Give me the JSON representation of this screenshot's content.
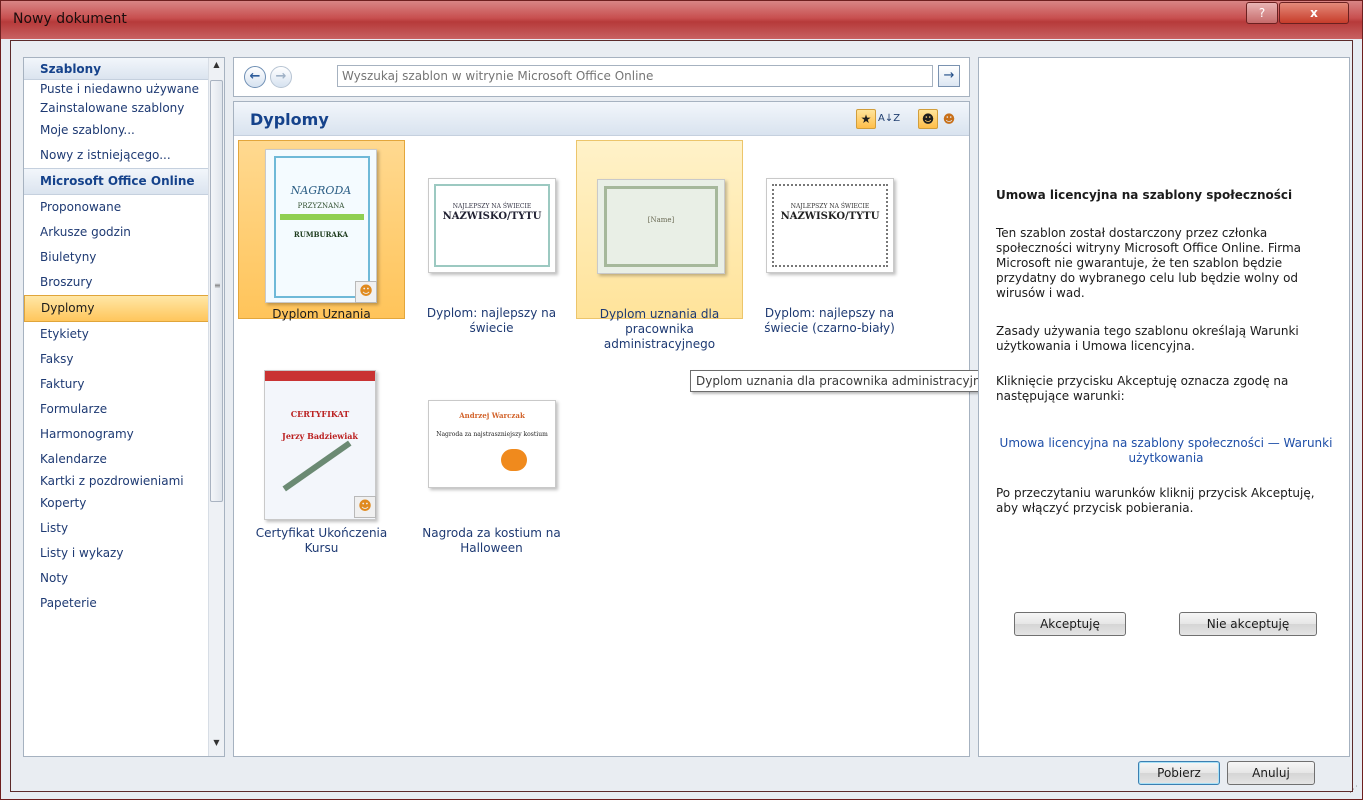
{
  "window": {
    "title": "Nowy dokument",
    "help_label": "?",
    "close_label": "x"
  },
  "sidebar": {
    "header": "Szablony",
    "items": [
      {
        "label": "Puste i niedawno używane"
      },
      {
        "label": "Zainstalowane szablony"
      },
      {
        "label": "Moje szablony..."
      },
      {
        "label": "Nowy z istniejącego..."
      },
      {
        "label": "Microsoft Office Online"
      },
      {
        "label": "Proponowane"
      },
      {
        "label": "Arkusze godzin"
      },
      {
        "label": "Biuletyny"
      },
      {
        "label": "Broszury"
      },
      {
        "label": "Dyplomy"
      },
      {
        "label": "Etykiety"
      },
      {
        "label": "Faksy"
      },
      {
        "label": "Faktury"
      },
      {
        "label": "Formularze"
      },
      {
        "label": "Harmonogramy"
      },
      {
        "label": "Kalendarze"
      },
      {
        "label": "Kartki z pozdrowieniami"
      },
      {
        "label": "Koperty"
      },
      {
        "label": "Listy"
      },
      {
        "label": "Listy i wykazy"
      },
      {
        "label": "Noty"
      },
      {
        "label": "Papeterie"
      }
    ],
    "selected": "Dyplomy"
  },
  "search": {
    "back_label": "←",
    "forward_label": "→",
    "placeholder": "Wyszukaj szablon w witrynie Microsoft Office Online",
    "go_label": "→"
  },
  "gallery": {
    "title": "Dyplomy",
    "sort_label": "A↓Z",
    "templates": [
      {
        "label": "Dyplom Uznania",
        "thumb_title": "NAGRODA",
        "thumb_name": "RUMBURAKA",
        "thumb_small": "PRZYZNANA"
      },
      {
        "label": "Dyplom: najlepszy na świecie",
        "thumb_title": "NAJLEPSZY NA ŚWIECIE",
        "thumb_name": "NAZWISKO/TYTU"
      },
      {
        "label": "Dyplom uznania dla pracownika administracyjnego",
        "thumb_name": "[Name]"
      },
      {
        "label": "Dyplom: najlepszy na świecie (czarno-biały)",
        "thumb_title": "NAJLEPSZY NA ŚWIECIE",
        "thumb_name": "NAZWISKO/TYTU"
      },
      {
        "label": "Certyfikat Ukończenia Kursu",
        "thumb_title": "CERTYFIKAT",
        "thumb_name": "Jerzy Badziewiak"
      },
      {
        "label": "Nagroda za kostium na Halloween",
        "thumb_title": "Andrzej Warczak",
        "thumb_name": "Nagroda za najstraszniejszy kostium"
      }
    ],
    "tooltip": "Dyplom uznania dla pracownika administracyjnego"
  },
  "license": {
    "title": "Umowa licencyjna na szablony społeczności",
    "para1": "Ten szablon został dostarczony przez członka społeczności witryny Microsoft Office Online. Firma Microsoft nie gwarantuje, że ten szablon będzie przydatny do wybranego celu lub będzie wolny od wirusów i wad.",
    "para2": "Zasady używania tego szablonu określają Warunki użytkowania i Umowa licencyjna.",
    "para3": "Kliknięcie przycisku Akceptuję oznacza zgodę na następujące warunki:",
    "link": "Umowa licencyjna na szablony społeczności — Warunki użytkowania",
    "para4": "Po przeczytaniu warunków kliknij przycisk Akceptuję, aby włączyć przycisk pobierania.",
    "accept_label": "Akceptuję",
    "decline_label": "Nie akceptuję"
  },
  "footer": {
    "download_label": "Pobierz",
    "cancel_label": "Anuluj"
  },
  "colors": {
    "title_bar": "#c84f4f",
    "selection": "#ffc65c",
    "link": "#1f4fa8",
    "heading": "#15428b"
  }
}
